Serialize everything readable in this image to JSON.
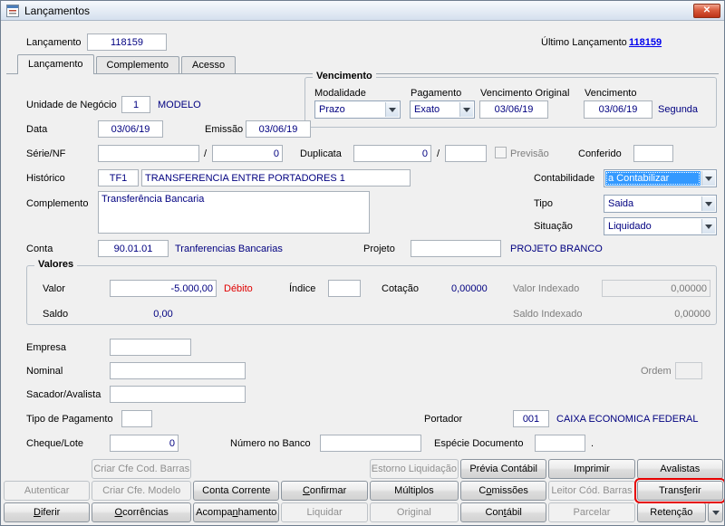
{
  "window": {
    "title": "Lançamentos",
    "close_glyph": "✕"
  },
  "header": {
    "lancamento_label": "Lançamento",
    "lancamento_value": "118159",
    "ultimo_lancamento_label": "Último Lançamento",
    "ultimo_lancamento_value": "118159"
  },
  "tabs": [
    {
      "label": "Lançamento"
    },
    {
      "label": "Complemento"
    },
    {
      "label": "Acesso"
    }
  ],
  "vencimento": {
    "title": "Vencimento",
    "modalidade_label": "Modalidade",
    "modalidade_value": "Prazo",
    "pagamento_label": "Pagamento",
    "pagamento_value": "Exato",
    "vencimento_original_label": "Vencimento Original",
    "vencimento_original_value": "03/06/19",
    "vencimento_label": "Vencimento",
    "vencimento_value": "03/06/19",
    "vencimento_weekday": "Segunda"
  },
  "form": {
    "unidade_negocio_label": "Unidade de Negócio",
    "unidade_negocio_value": "1",
    "unidade_negocio_desc": "MODELO",
    "data_label": "Data",
    "data_value": "03/06/19",
    "emissao_label": "Emissão",
    "emissao_value": "03/06/19",
    "serie_nf_label": "Série/NF",
    "serie_nf_value": "",
    "serie_nf_slash": "/",
    "serie_nf_value2": "0",
    "duplicata_label": "Duplicata",
    "duplicata_value": "0",
    "duplicata_slash": "/",
    "duplicata_value2": "",
    "previsao_label": "Previsão",
    "conferido_label": "Conferido",
    "conferido_value": "",
    "historico_label": "Histórico",
    "historico_code": "TF1",
    "historico_desc": "TRANSFERENCIA ENTRE PORTADORES 1",
    "contabilidade_label": "Contabilidade",
    "contabilidade_value": "a Contabilizar",
    "complemento_label": "Complemento",
    "complemento_value": "Transferência Bancaria",
    "tipo_label": "Tipo",
    "tipo_value": "Saida",
    "situacao_label": "Situação",
    "situacao_value": "Liquidado",
    "conta_label": "Conta",
    "conta_value": "90.01.01",
    "conta_desc": "Tranferencias Bancarias",
    "projeto_label": "Projeto",
    "projeto_value": "",
    "projeto_desc": "PROJETO BRANCO"
  },
  "valores": {
    "title": "Valores",
    "valor_label": "Valor",
    "valor_value": "-5.000,00",
    "valor_flag": "Débito",
    "indice_label": "Índice",
    "indice_value": "",
    "cotacao_label": "Cotação",
    "cotacao_value": "0,00000",
    "valor_indexado_label": "Valor Indexado",
    "valor_indexado_value": "0,00000",
    "saldo_label": "Saldo",
    "saldo_value": "0,00",
    "saldo_indexado_label": "Saldo Indexado",
    "saldo_indexado_value": "0,00000"
  },
  "detalhes": {
    "empresa_label": "Empresa",
    "empresa_value": "",
    "nominal_label": "Nominal",
    "nominal_value": "",
    "ordem_label": "Ordem",
    "ordem_value": "",
    "sacador_avalista_label": "Sacador/Avalista",
    "sacador_avalista_value": "",
    "tipo_pagamento_label": "Tipo de Pagamento",
    "tipo_pagamento_value": "",
    "portador_label": "Portador",
    "portador_value": "001",
    "portador_desc": "CAIXA ECONOMICA FEDERAL",
    "cheque_lote_label": "Cheque/Lote",
    "cheque_lote_value": "0",
    "numero_banco_label": "Número no Banco",
    "numero_banco_value": "",
    "especie_documento_label": "Espécie Documento",
    "especie_documento_value": "",
    "especie_documento_suffix": "."
  },
  "buttons": {
    "rows": [
      [
        null,
        {
          "label": "Criar Cfe Cod. Barras",
          "disabled": true
        },
        null,
        null,
        {
          "label": "Estorno Liquidação",
          "disabled": true
        },
        {
          "label": "Prévia Contábil"
        },
        {
          "label": "Imprimir"
        },
        {
          "label": "Avalistas"
        }
      ],
      [
        {
          "label": "Autenticar",
          "disabled": true
        },
        {
          "label": "Criar Cfe. Modelo",
          "disabled": true
        },
        {
          "label": "Conta Corrente"
        },
        {
          "label": "Confirmar",
          "underline": "C"
        },
        {
          "label": "Múltiplos"
        },
        {
          "label": "Comissões",
          "underline": "o"
        },
        {
          "label": "Leitor Cód. Barras",
          "disabled": true
        },
        {
          "label": "Transferir",
          "underline": "f",
          "highlighted": true
        }
      ],
      [
        {
          "label": "Diferir",
          "underline": "D"
        },
        {
          "label": "Ocorrências",
          "underline": "O"
        },
        {
          "label": "Acompanhamento",
          "underline": "n"
        },
        {
          "label": "Liquidar",
          "disabled": true
        },
        {
          "label": "Original",
          "disabled": true
        },
        {
          "label": "Contábil",
          "underline": "t"
        },
        {
          "label": "Parcelar",
          "disabled": true
        },
        {
          "label": "Retenção",
          "dropdown": true
        }
      ]
    ]
  },
  "colors": {
    "value_text": "#000080",
    "link": "#0000ee",
    "debit_red": "#e00000",
    "highlight_border": "#e60000"
  }
}
